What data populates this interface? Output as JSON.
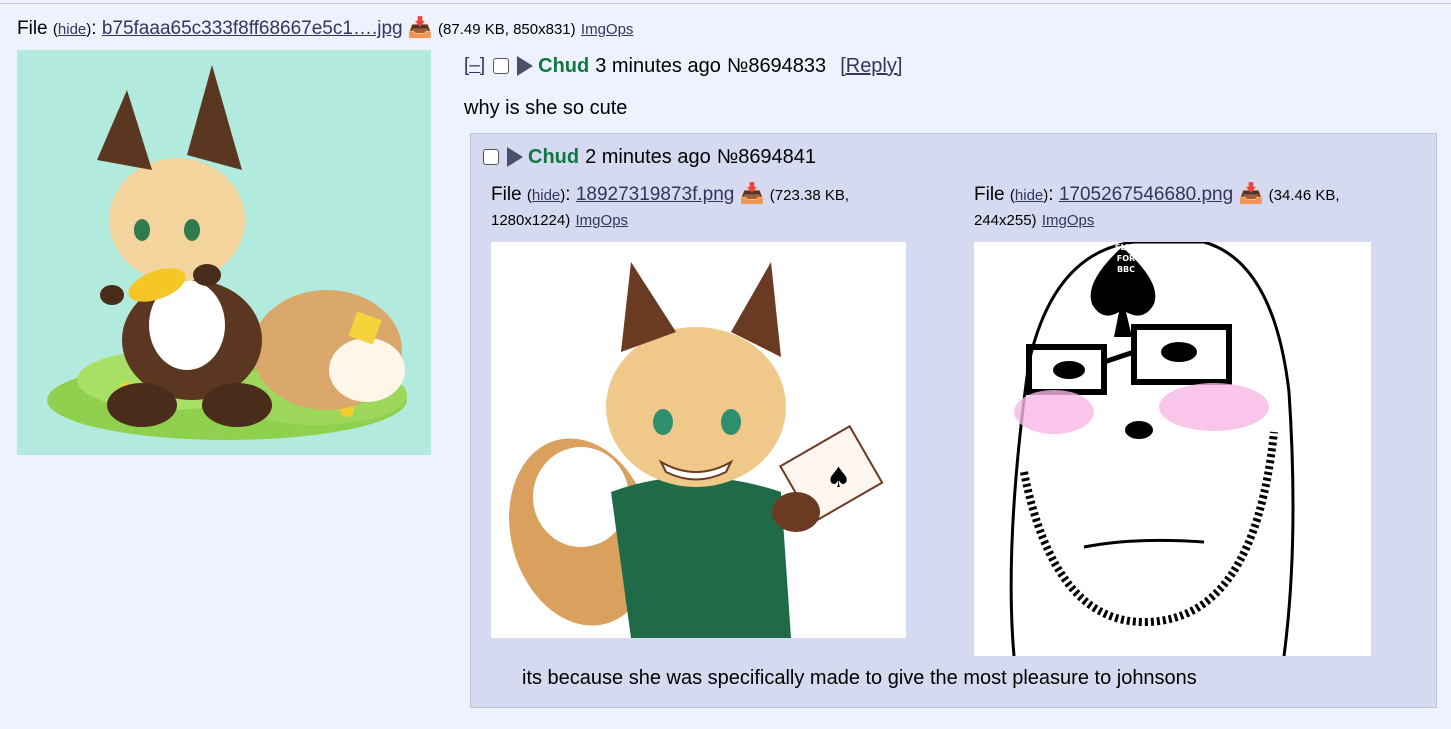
{
  "op": {
    "file": {
      "prefix": "File",
      "hide": "hide",
      "filename": "b75faaa65c333f8ff68667e5c1….jpg",
      "size": "(87.49 KB, 850x831)",
      "imgops": "ImgOps"
    },
    "hider": "[–]",
    "name": "Chud",
    "date": "3 minutes ago",
    "number": "№8694833",
    "reply_link": "[Reply]",
    "message": "why is she so cute"
  },
  "reply": {
    "name": "Chud",
    "date": "2 minutes ago",
    "number": "№8694841",
    "files": [
      {
        "prefix": "File",
        "hide": "hide",
        "filename": "18927319873f.png",
        "size_a": "(723.38 KB,",
        "size_b": "1280x1224)",
        "imgops": "ImgOps"
      },
      {
        "prefix": "File",
        "hide": "hide",
        "filename": "1705267546680.png",
        "size_a": "(34.46 KB,",
        "size_b": "244x255)",
        "imgops": "ImgOps"
      }
    ],
    "message": "its because she was specifically made to give the most pleasure to johnsons",
    "img2_text": [
      "SLUT",
      "FOR",
      "BBC"
    ]
  },
  "icons": {
    "download": "download-icon",
    "expand": "triangle-right-icon"
  },
  "colors": {
    "background": "#eef2ff",
    "reply_bg": "#d6daf0",
    "name": "#117743",
    "link": "#34345c",
    "thumb_bg": "#b2ebdd"
  }
}
